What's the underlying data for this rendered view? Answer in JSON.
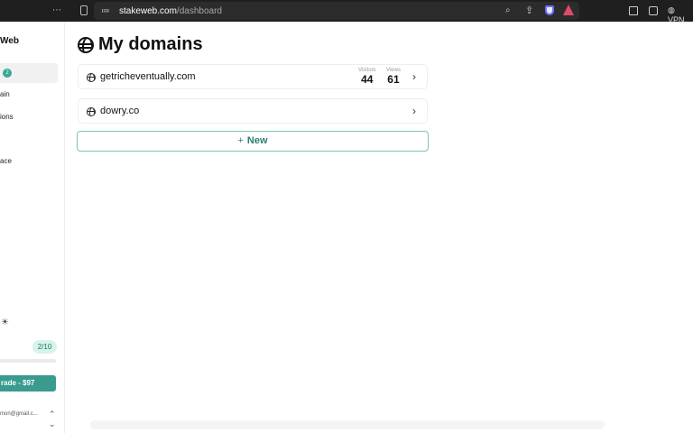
{
  "browser": {
    "url_host": "stakeweb.com",
    "url_path": "/dashboard",
    "vpn_label": "VPN",
    "icons": [
      "menu-dots-icon",
      "sidebar-toggle-icon",
      "tune-icon",
      "zoom-icon",
      "share-icon",
      "shield-icon",
      "triangle-icon",
      "panel-icon",
      "wallet-icon",
      "globe-icon"
    ]
  },
  "sidebar": {
    "brand": "Web",
    "items": [
      {
        "label": "",
        "badge": "2"
      },
      {
        "label": "ain"
      },
      {
        "label": "ions"
      },
      {
        "label": "ace"
      }
    ],
    "theme_icon": "sun-icon",
    "usage": "2/10",
    "upgrade_label": "rade - $97",
    "account": "mon@gmail.c..."
  },
  "main": {
    "title": "My domains",
    "domains": [
      {
        "name": "getricheventually.com",
        "visitors_label": "Visitors",
        "visitors": "44",
        "views_label": "Views",
        "views": "61"
      },
      {
        "name": "dowry.co"
      }
    ],
    "new_label": "New"
  },
  "colors": {
    "accent": "#3a9b8f",
    "badge_bg": "#d6f3ec",
    "topbar": "#1f1f1f"
  }
}
